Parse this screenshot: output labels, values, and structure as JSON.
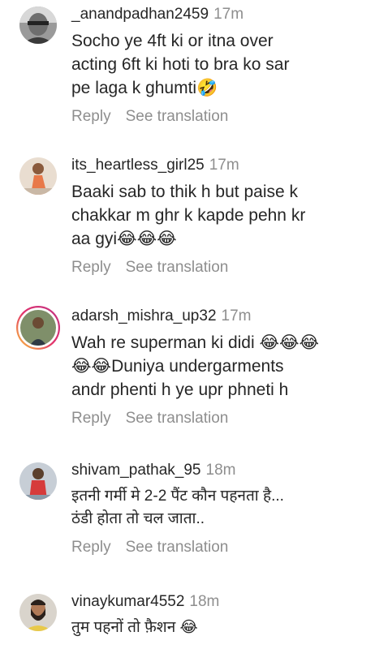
{
  "comments": [
    {
      "username": "_anandpadhan2459",
      "time": "17m",
      "text": "Socho ye 4ft ki or itna over\nacting 6ft ki hoti to  bra ko sar\npe laga k ghumti🤣",
      "reply": "Reply",
      "translate": "See translation",
      "avatar_icon": "avatar-man-grayscale"
    },
    {
      "username": "its_heartless_girl25",
      "time": "17m",
      "text": "Baaki sab to thik h but paise k\nchakkar m ghr k kapde pehn kr\naa gyi😂😂😂",
      "reply": "Reply",
      "translate": "See translation",
      "avatar_icon": "avatar-girl-orange-dress"
    },
    {
      "username": "adarsh_mishra_up32",
      "time": "17m",
      "text": "Wah re superman ki didi 😂😂😂\n😂😂Duniya undergarments\nandr phenti h ye upr phneti h",
      "reply": "Reply",
      "translate": "See translation",
      "avatar_icon": "avatar-story-ring"
    },
    {
      "username": "shivam_pathak_95",
      "time": "18m",
      "text": "इतनी गर्मी मे 2-2 पैंट कौन पहनता है...\nठंडी होता तो चल जाता..",
      "reply": "Reply",
      "translate": "See translation",
      "avatar_icon": "avatar-man-red-shirt"
    },
    {
      "username": "vinaykumar4552",
      "time": "18m",
      "text": "तुम पहनों तो फ़ैशन 😂",
      "reply": "",
      "translate": "",
      "avatar_icon": "avatar-man-beard"
    }
  ]
}
